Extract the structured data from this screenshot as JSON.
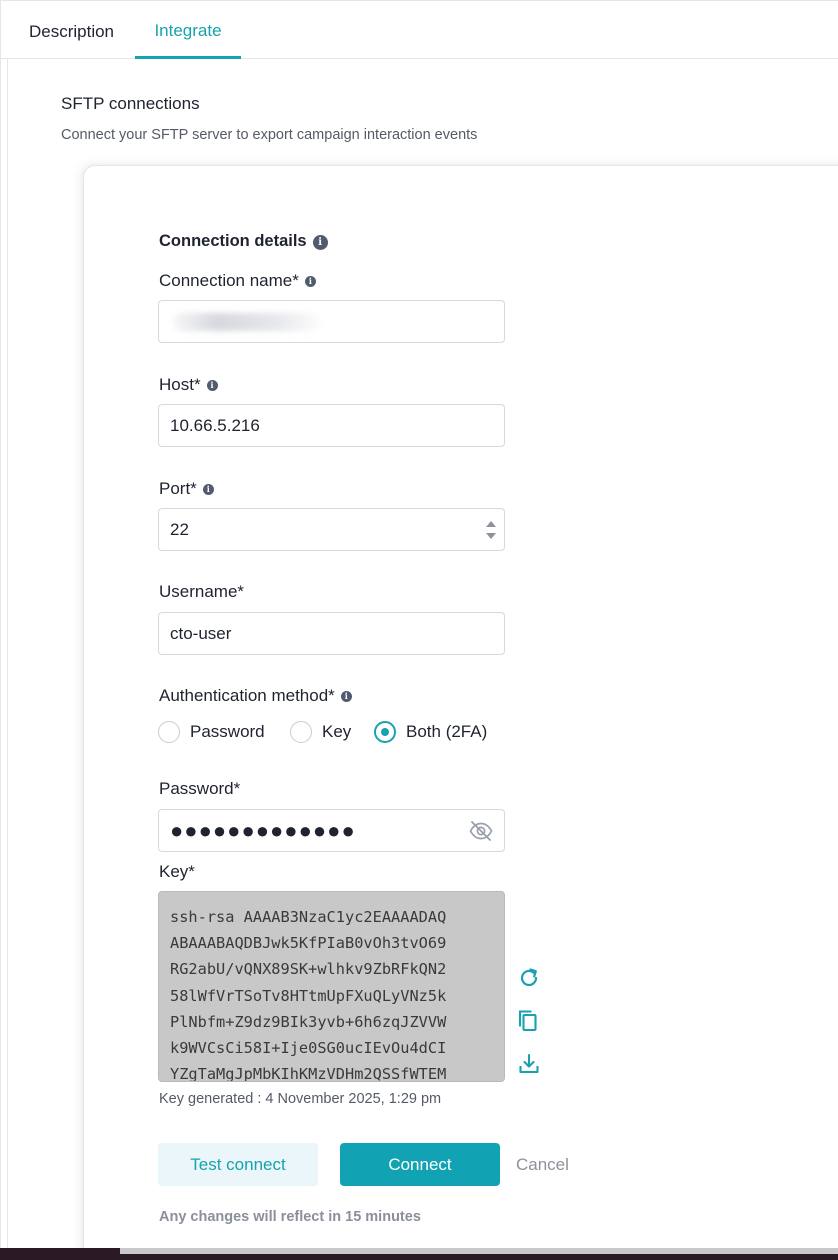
{
  "tabs": [
    {
      "label": "Description",
      "active": false
    },
    {
      "label": "Integrate",
      "active": true
    }
  ],
  "section": {
    "title": "SFTP connections",
    "subtitle": "Connect your SFTP server to export campaign interaction events"
  },
  "form": {
    "heading": "Connection details",
    "connection_name": {
      "label": "Connection name*",
      "value": ""
    },
    "host": {
      "label": "Host*",
      "value": "10.66.5.216"
    },
    "port": {
      "label": "Port*",
      "value": "22"
    },
    "username": {
      "label": "Username*",
      "value": "cto-user"
    },
    "auth": {
      "label": "Authentication method*",
      "options": [
        "Password",
        "Key",
        "Both (2FA)"
      ],
      "selected": "Both (2FA)"
    },
    "password": {
      "label": "Password*",
      "masked": "●●●●●●●●●●●●●"
    },
    "key": {
      "label": "Key*",
      "lines": [
        "ssh-rsa AAAAB3NzaC1yc2EAAAADAQ",
        "ABAAABAQDBJwk5KfPIaB0vOh3tvO69",
        "RG2abU/vQNX89SK+wlhkv9ZbRFkQN2",
        "58lWfVrTSoTv8HTtmUpFXuQLyVNz5k",
        "PlNbfm+Z9dz9BIk3yvb+6h6zqJZVVW",
        "k9WVCsCi58I+Ije0SG0ucIEvOu4dCI",
        "YZgTaMgJpMbKIhKMzVDHm2QSSfWTEM"
      ],
      "generated": "Key generated : 4 November 2025, 1:29 pm"
    }
  },
  "icons": {
    "info": "info-icon",
    "refresh": "refresh-icon",
    "copy": "copy-icon",
    "download": "download-icon",
    "eye": "eye-off-icon",
    "stepper": "stepper-arrows-icon"
  },
  "actions": {
    "test_label": "Test connect",
    "connect_label": "Connect",
    "cancel_label": "Cancel"
  },
  "note": "Any changes will reflect in 15 minutes",
  "colors": {
    "accent": "#17a2b1",
    "primary_button": "#11a3b3",
    "secondary_button_bg": "#eaf6f9",
    "key_box_bg": "#c8c8c8"
  }
}
